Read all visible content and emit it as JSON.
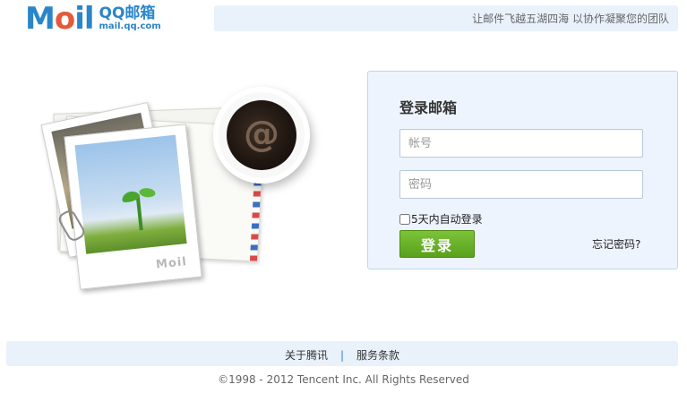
{
  "header": {
    "logo_mail": "Mail",
    "logo_qq": "QQ邮箱",
    "logo_url": "mail.qq.com",
    "slogan": "让邮件飞越五湖四海 以协作凝聚您的团队"
  },
  "illustration": {
    "photo_mark": "Mail",
    "cup_symbol": "@"
  },
  "login": {
    "title": "登录邮箱",
    "username_placeholder": "帐号",
    "password_placeholder": "密码",
    "username_value": "",
    "password_value": "",
    "remember_label": "5天内自动登录",
    "remember_checked": false,
    "submit_label": "登录",
    "forgot_label": "忘记密码?"
  },
  "footer": {
    "links": [
      "关于腾讯",
      "服务条款"
    ],
    "separator": "|",
    "copyright": "©1998 - 2012 Tencent Inc. All Rights Reserved"
  },
  "colors": {
    "brand_blue": "#2a85c9",
    "panel_bg": "#eef4fd",
    "button_green": "#5aa11c"
  }
}
